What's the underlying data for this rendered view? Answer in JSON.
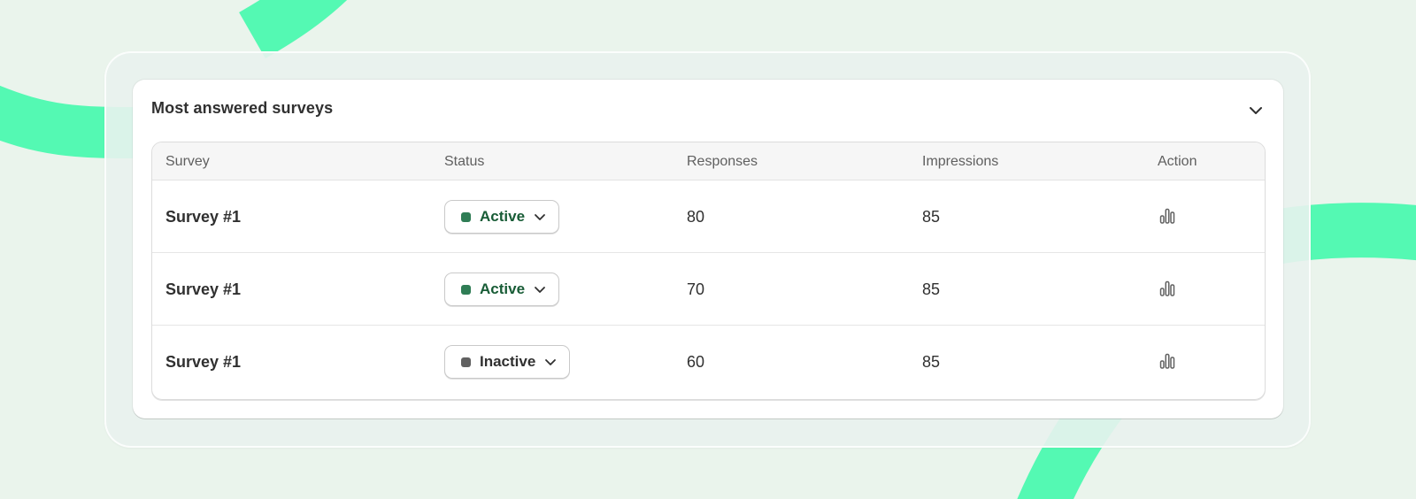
{
  "card": {
    "title": "Most answered surveys"
  },
  "table": {
    "columns": [
      "Survey",
      "Status",
      "Responses",
      "Impressions",
      "Action"
    ],
    "rows": [
      {
        "survey": "Survey #1",
        "status": "Active",
        "responses": "80",
        "impressions": "85"
      },
      {
        "survey": "Survey #1",
        "status": "Active",
        "responses": "70",
        "impressions": "85"
      },
      {
        "survey": "Survey #1",
        "status": "Inactive",
        "responses": "60",
        "impressions": "85"
      }
    ]
  },
  "icons": {
    "collapse": "chevron-down-icon",
    "status_caret": "chevron-down-icon",
    "action": "bar-chart-icon"
  },
  "colors": {
    "background": "#eaf4ec",
    "ribbon": "#54f9b3",
    "active_text": "#185c36",
    "active_dot": "#2f7d55",
    "inactive_dot": "#616161"
  }
}
